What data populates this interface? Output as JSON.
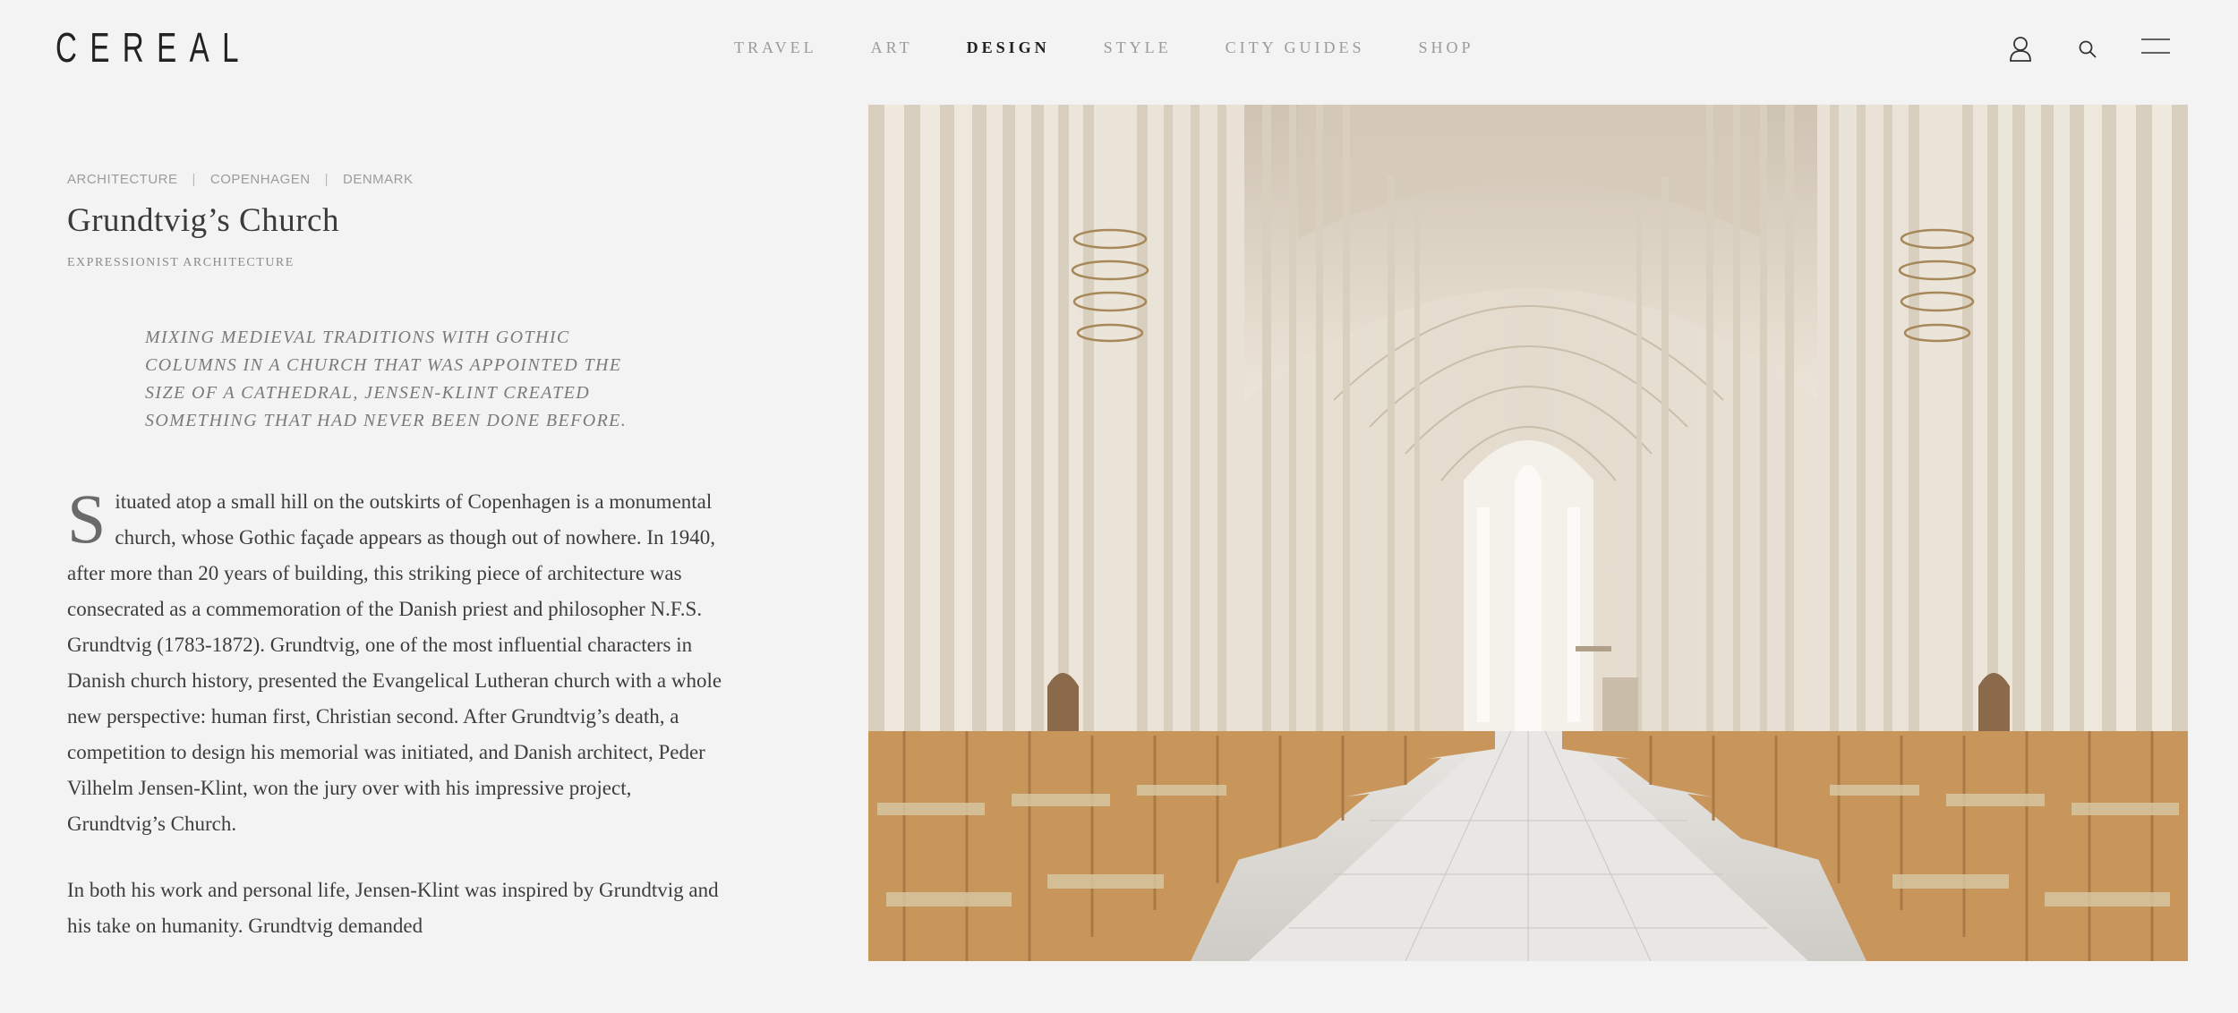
{
  "brand": {
    "logo": "CEREAL"
  },
  "nav": {
    "items": [
      {
        "label": "TRAVEL",
        "active": false
      },
      {
        "label": "ART",
        "active": false
      },
      {
        "label": "DESIGN",
        "active": true
      },
      {
        "label": "STYLE",
        "active": false
      },
      {
        "label": "CITY GUIDES",
        "active": false
      },
      {
        "label": "SHOP",
        "active": false
      }
    ]
  },
  "header_icons": [
    "user-icon",
    "search-icon",
    "menu-icon"
  ],
  "article": {
    "breadcrumb": [
      "ARCHITECTURE",
      "COPENHAGEN",
      "DENMARK"
    ],
    "title": "Grundtvig’s Church",
    "subtitle": "EXPRESSIONIST ARCHITECTURE",
    "pullquote": "MIXING MEDIEVAL TRADITIONS WITH GOTHIC COLUMNS IN A CHURCH THAT WAS APPOINTED THE SIZE OF A CATHEDRAL, JENSEN-KLINT CREATED SOMETHING THAT HAD NEVER BEEN DONE BEFORE.",
    "dropcap": "S",
    "paragraph1": "ituated atop a small hill on the outskirts of Copenhagen is a monumental church, whose Gothic façade appears as though out of nowhere. In 1940, after more than 20 years of building, this striking piece of architecture was consecrated as a commemoration of the Danish priest and philosopher N.F.S. Grundtvig (1783-1872). Grundtvig, one of the most influential characters in Danish church history, presented the Evangelical Lutheran church with a whole new perspective: human first, Christian second. After Grundtvig’s death, a competition to design his memorial was initiated, and Danish architect, Peder Vilhelm Jensen-Klint, won the jury over with his impressive project, Grundtvig’s Church.",
    "paragraph2": "In both his work and personal life, Jensen-Klint was inspired by Grundtvig and his take on humanity. Grundtvig demanded"
  },
  "hero_image": {
    "subject": "church-interior-photo",
    "colors": {
      "wall": "#ece6dc",
      "shadow": "#cbbfae",
      "chair": "#c8955a",
      "floor": "#dcdad6"
    }
  }
}
